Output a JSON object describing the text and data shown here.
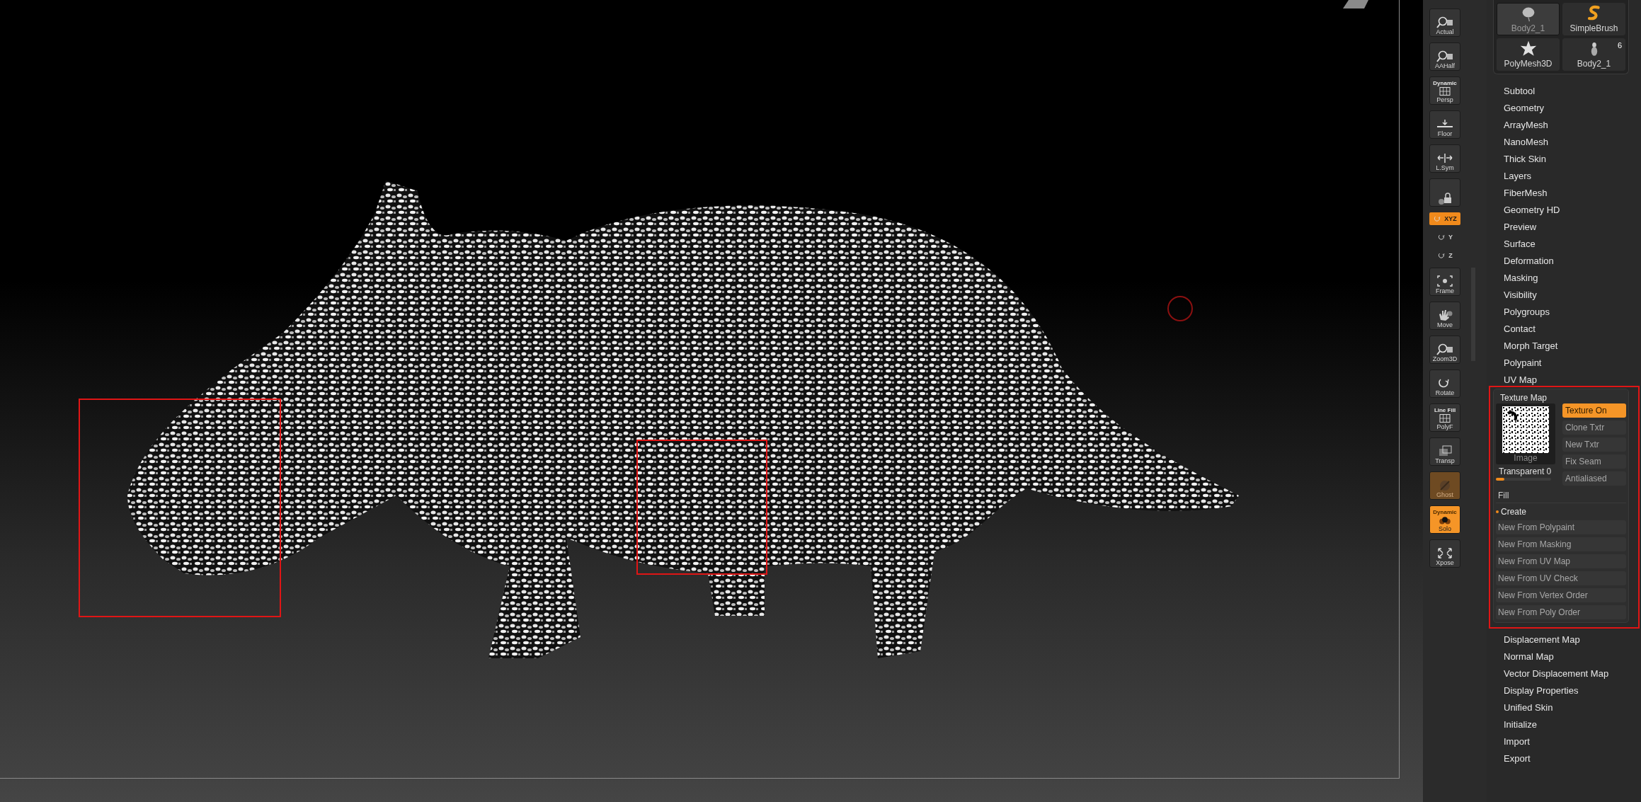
{
  "viewport": {
    "model": {
      "kind": "textured-mesh"
    },
    "brush_cursor_visible": true,
    "annotations": [
      {
        "kind": "box"
      },
      {
        "kind": "box"
      },
      {
        "kind": "box"
      }
    ]
  },
  "toolbar": [
    {
      "label": "Actual",
      "kind": "magnifier",
      "on": false
    },
    {
      "label": "AAHalf",
      "kind": "magnifier",
      "on": false
    },
    {
      "label": "Persp",
      "sublabel": "Dynamic",
      "kind": "grid",
      "on": false
    },
    {
      "label": "Floor",
      "kind": "floor",
      "on": false
    },
    {
      "label": "L.Sym",
      "kind": "arrows",
      "on": false
    },
    {
      "kind": "lock",
      "on": false
    },
    {
      "label": "XYZ",
      "kind": "axis",
      "on": true
    },
    {
      "label": "Y",
      "kind": "axis",
      "on": false
    },
    {
      "label": "Z",
      "kind": "axis",
      "on": false
    },
    {
      "label": "Frame",
      "kind": "frame",
      "on": false
    },
    {
      "label": "Move",
      "kind": "hand",
      "on": false
    },
    {
      "label": "Zoom3D",
      "kind": "magnifier",
      "on": false
    },
    {
      "label": "Rotate",
      "kind": "rotate",
      "on": false
    },
    {
      "label": "PolyF",
      "sublabel": "Line Fill",
      "kind": "grid",
      "on": false
    },
    {
      "label": "Transp",
      "kind": "squares",
      "on": false
    },
    {
      "label": "Ghost",
      "kind": "brush",
      "on": true,
      "disabled": true
    },
    {
      "label": "Solo",
      "sublabel": "Dynamic",
      "kind": "circles",
      "on": true,
      "disabled": false
    },
    {
      "label": "Xpose",
      "kind": "expand",
      "on": false
    }
  ],
  "tool_tiles": [
    {
      "label": "Body2_1",
      "kind": "blob",
      "selected": true
    },
    {
      "label": "SimpleBrush",
      "kind": "s-brush",
      "selected": false
    },
    {
      "label": "PolyMesh3D",
      "kind": "star",
      "selected": false
    },
    {
      "label": "Body2_1",
      "kind": "figure",
      "selected": false,
      "count": "6"
    }
  ],
  "menu_items_top": [
    "Subtool",
    "Geometry",
    "ArrayMesh",
    "NanoMesh",
    "Thick Skin",
    "Layers",
    "FiberMesh",
    "Geometry HD",
    "Preview",
    "Surface",
    "Deformation",
    "Masking",
    "Visibility",
    "Polygroups",
    "Contact",
    "Morph Target",
    "Polypaint",
    "UV Map"
  ],
  "texture_map": {
    "title": "Texture Map",
    "image_label": "Image",
    "buttons": [
      {
        "label": "Texture On",
        "on": true
      },
      {
        "label": "Clone Txtr",
        "on": false
      },
      {
        "label": "New Txtr",
        "on": false
      },
      {
        "label": "Fix Seam",
        "on": false
      },
      {
        "label": "Antialiased",
        "on": false
      }
    ],
    "transparent": {
      "label": "Transparent 0",
      "level": 0.15
    },
    "fill": "Fill",
    "create": {
      "label": "Create",
      "expanded": true
    },
    "create_buttons": [
      "New From Polypaint",
      "New From Masking",
      "New From UV Map",
      "New From UV Check",
      "New From Vertex Order",
      "New From Poly Order"
    ]
  },
  "menu_items_bottom": [
    "Displacement Map",
    "Normal Map",
    "Vector Displacement Map",
    "Display Properties",
    "Unified Skin",
    "Initialize",
    "Import",
    "Export"
  ]
}
